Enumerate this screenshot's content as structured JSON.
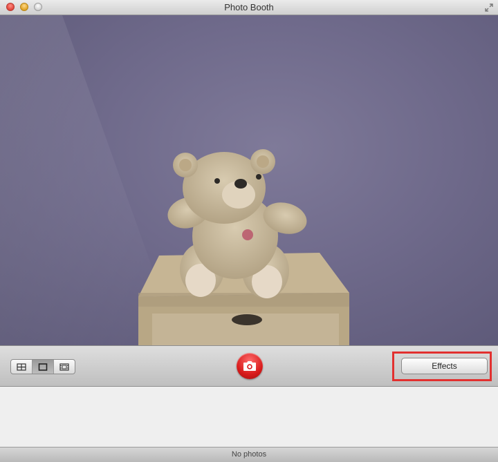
{
  "window": {
    "title": "Photo Booth"
  },
  "toolbar": {
    "view_modes": [
      {
        "name": "four-up-photo",
        "icon": "grid-icon"
      },
      {
        "name": "single-photo",
        "icon": "square-icon",
        "active": true
      },
      {
        "name": "movie-clip",
        "icon": "film-icon"
      }
    ],
    "shutter_icon": "camera-icon",
    "effects_label": "Effects"
  },
  "status": {
    "text": "No photos"
  },
  "colors": {
    "shutter": "#d81b1b",
    "highlight": "#e2302f"
  }
}
